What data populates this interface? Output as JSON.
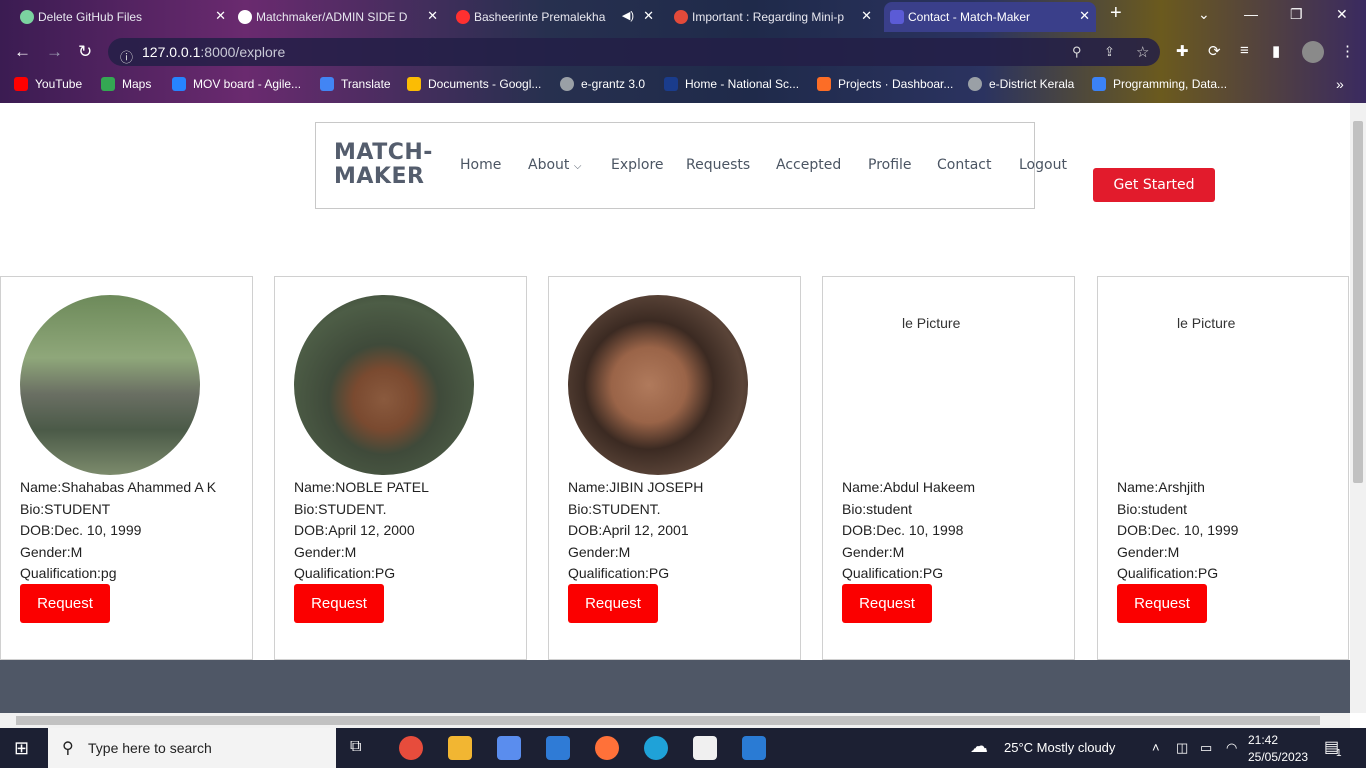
{
  "browser": {
    "tabs": [
      {
        "title": "Delete GitHub Files",
        "color": "#7bd3a0"
      },
      {
        "title": "Matchmaker/ADMIN SIDE D",
        "color": "#ffffff"
      },
      {
        "title": "Basheerinte Premalekha",
        "color": "#ff3030"
      },
      {
        "title": "Important : Regarding Mini-p",
        "color": "#e24a3a"
      },
      {
        "title": "Contact - Match-Maker",
        "color": "#5b5bd6"
      }
    ],
    "url_host": "127.0.0.1",
    "url_rest": ":8000/explore",
    "bookmarks": [
      {
        "label": "YouTube",
        "color": "#ff0000"
      },
      {
        "label": "Maps",
        "color": "#34a853"
      },
      {
        "label": "MOV board - Agile...",
        "color": "#2684ff"
      },
      {
        "label": "Translate",
        "color": "#4285f4"
      },
      {
        "label": "Documents - Googl...",
        "color": "#fbbc04"
      },
      {
        "label": "e-grantz 3.0",
        "color": "#9aa0a6"
      },
      {
        "label": "Home - National Sc...",
        "color": "#1a3c8c"
      },
      {
        "label": "Projects · Dashboar...",
        "color": "#fc6d26"
      },
      {
        "label": "e-District Kerala",
        "color": "#9aa0a6"
      },
      {
        "label": "Programming, Data...",
        "color": "#3b82f6"
      }
    ]
  },
  "site": {
    "logo_line1": "MATCH-",
    "logo_line2": "MAKER",
    "nav": {
      "home": "Home",
      "about": "About",
      "explore": "Explore",
      "requests": "Requests",
      "accepted": "Accepted",
      "profile": "Profile",
      "contact": "Contact",
      "logout": "Logout"
    },
    "cta": "Get Started",
    "accent": "#e21b2c"
  },
  "profiles": [
    {
      "name": "Name:Shahabas Ahammed A K",
      "bio": "Bio:STUDENT",
      "dob": "DOB:Dec. 10, 1999",
      "gender": "Gender:M",
      "qualification": "Qualification:pg",
      "button": "Request"
    },
    {
      "name": "Name:NOBLE PATEL",
      "bio": "Bio:STUDENT.",
      "dob": "DOB:April 12, 2000",
      "gender": "Gender:M",
      "qualification": "Qualification:PG",
      "button": "Request"
    },
    {
      "name": "Name:JIBIN JOSEPH",
      "bio": "Bio:STUDENT.",
      "dob": "DOB:April 12, 2001",
      "gender": "Gender:M",
      "qualification": "Qualification:PG",
      "button": "Request"
    },
    {
      "name": "Name:Abdul Hakeem",
      "bio": "Bio:student",
      "dob": "DOB:Dec. 10, 1998",
      "gender": "Gender:M",
      "qualification": "Qualification:PG",
      "button": "Request",
      "broken_image": "le Picture"
    },
    {
      "name": "Name:Arshjith",
      "bio": "Bio:student",
      "dob": "DOB:Dec. 10, 1999",
      "gender": "Gender:M",
      "qualification": "Qualification:PG",
      "button": "Request",
      "broken_image": "le Picture"
    }
  ],
  "taskbar": {
    "search_placeholder": "Type here to search",
    "weather": "25°C  Mostly cloudy",
    "time": "21:42",
    "date": "25/05/2023",
    "notifications": "1"
  }
}
